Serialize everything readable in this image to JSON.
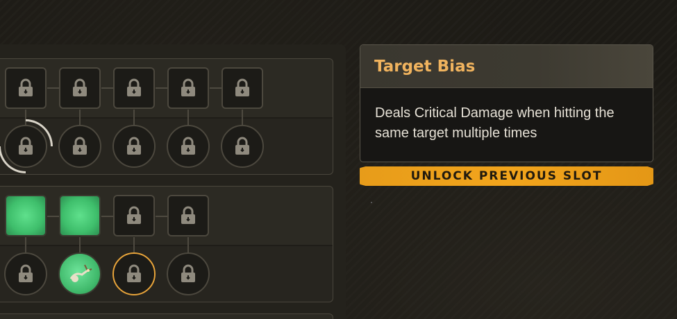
{
  "tooltip": {
    "title": "Target Bias",
    "description": "Deals Critical Damage when hitting the same target multiple times"
  },
  "unlock_button": {
    "label": "UNLOCK PREVIOUS SLOT"
  },
  "skill_tree": {
    "groups": [
      {
        "top_slots": [
          "locked",
          "locked",
          "locked",
          "locked",
          "locked"
        ],
        "bottom_slots": [
          "locked-highlighted",
          "locked",
          "locked",
          "locked",
          "locked"
        ]
      },
      {
        "top_slots": [
          "active",
          "active",
          "locked",
          "locked"
        ],
        "bottom_slots": [
          "locked",
          "learned-skill",
          "locked-selected",
          "locked"
        ]
      }
    ]
  },
  "colors": {
    "accent": "#f0b35e",
    "unlock_bar": "#f2a51c",
    "active_slot": "#5fe08c",
    "selected_ring": "#e8a43a"
  },
  "icons": [
    "lock-icon",
    "skill-portrait-icon"
  ]
}
